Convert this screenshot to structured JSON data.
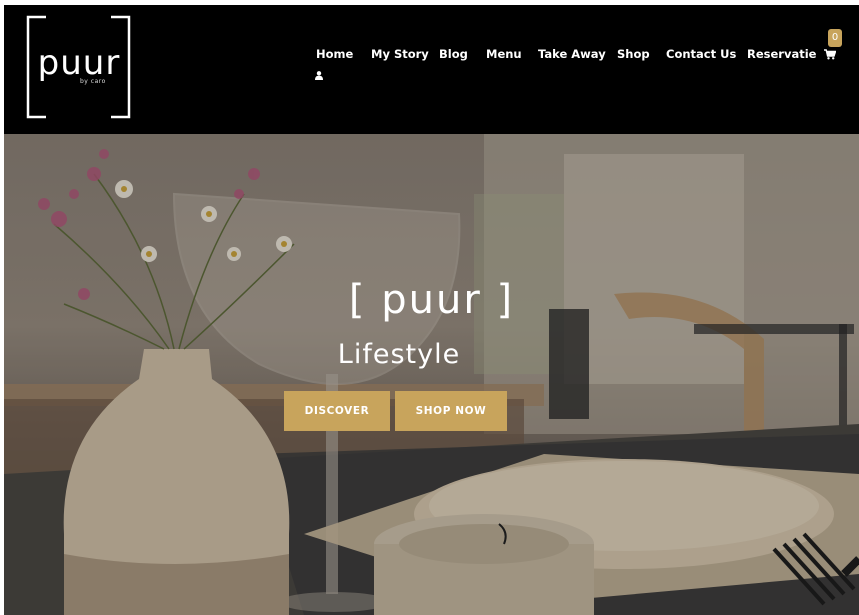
{
  "header": {
    "logo": {
      "word": "puur",
      "sub": "by caro"
    },
    "nav": [
      {
        "label": "Home",
        "id": "home"
      },
      {
        "label": "My Story",
        "id": "my-story"
      },
      {
        "label": "Blog",
        "id": "blog"
      },
      {
        "label": "Menu",
        "id": "menu"
      },
      {
        "label": "Take Away",
        "id": "take-away"
      },
      {
        "label": "Shop",
        "id": "shop"
      },
      {
        "label": "Contact Us",
        "id": "contact-us"
      },
      {
        "label": "Reservatie",
        "id": "reservatie"
      }
    ],
    "user_icon": "user-icon",
    "cart": {
      "icon": "cart-icon",
      "count": "0"
    }
  },
  "hero": {
    "title": "[ puur ]",
    "subtitle": "Lifestyle",
    "buttons": {
      "discover": "DISCOVER",
      "shop_now": "SHOP NOW"
    }
  },
  "colors": {
    "header_bg": "#000000",
    "accent": "#c8a45c",
    "text": "#ffffff"
  }
}
